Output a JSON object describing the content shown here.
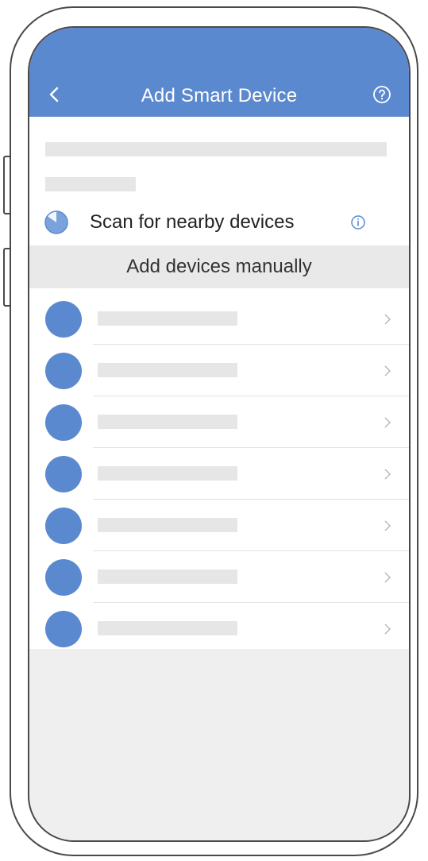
{
  "header": {
    "title": "Add Smart Device",
    "back_icon": "chevron-left-icon",
    "help_icon": "question-circle-icon",
    "color": "#5b89cf"
  },
  "scan": {
    "label": "Scan for nearby devices",
    "icon": "radar-scan-icon",
    "info_icon": "info-circle-icon"
  },
  "manual": {
    "label": "Add devices manually"
  },
  "devices": [
    {
      "icon": "device-circle-icon"
    },
    {
      "icon": "device-circle-icon"
    },
    {
      "icon": "device-circle-icon"
    },
    {
      "icon": "device-circle-icon"
    },
    {
      "icon": "device-circle-icon"
    },
    {
      "icon": "device-circle-icon"
    },
    {
      "icon": "device-circle-icon"
    }
  ]
}
